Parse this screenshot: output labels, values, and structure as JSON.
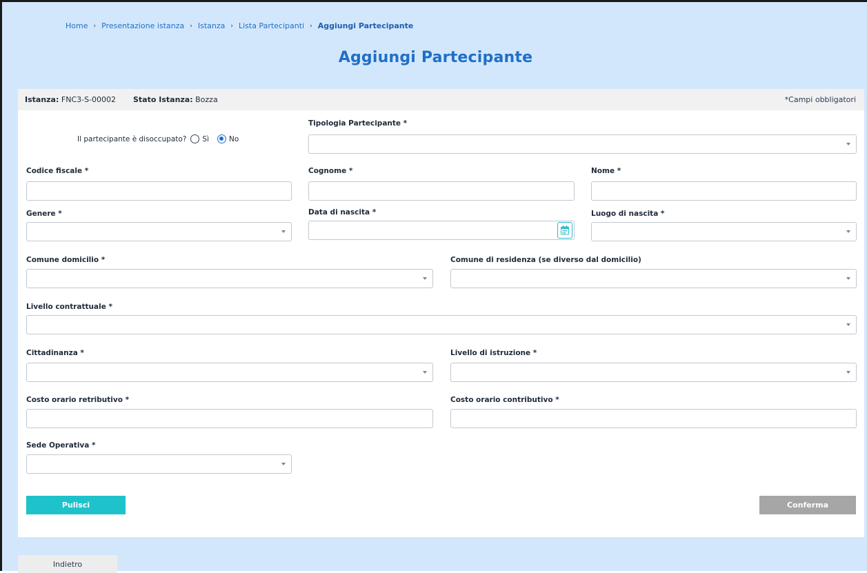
{
  "breadcrumb": {
    "items": [
      "Home",
      "Presentazione istanza",
      "Istanza",
      "Lista Partecipanti"
    ],
    "current": "Aggiungi Partecipante",
    "separator": "›"
  },
  "page": {
    "title": "Aggiungi Partecipante"
  },
  "info": {
    "istanza_label": "Istanza:",
    "istanza_value": "FNC3-S-00002",
    "stato_label": "Stato Istanza:",
    "stato_value": "Bozza",
    "required_note": "*Campi obbligatori"
  },
  "form": {
    "disoccupato": {
      "question": "Il partecipante è disoccupato?",
      "options": [
        "Sì",
        "No"
      ],
      "selected": "No"
    },
    "tipologia_partecipante": {
      "label": "Tipologia Partecipante *",
      "value": ""
    },
    "codice_fiscale": {
      "label": "Codice fiscale *",
      "value": ""
    },
    "cognome": {
      "label": "Cognome *",
      "value": ""
    },
    "nome": {
      "label": "Nome *",
      "value": ""
    },
    "genere": {
      "label": "Genere *",
      "value": ""
    },
    "data_nascita": {
      "label": "Data di nascita *",
      "value": ""
    },
    "luogo_nascita": {
      "label": "Luogo di nascita *",
      "value": ""
    },
    "comune_domicilio": {
      "label": "Comune domicilio *",
      "value": ""
    },
    "comune_residenza": {
      "label": "Comune di residenza (se diverso dal domicilio)",
      "value": ""
    },
    "livello_contrattuale": {
      "label": "Livello contrattuale *",
      "value": ""
    },
    "cittadinanza": {
      "label": "Cittadinanza *",
      "value": ""
    },
    "livello_istruzione": {
      "label": "Livello di istruzione *",
      "value": ""
    },
    "costo_retributivo": {
      "label": "Costo orario retributivo *",
      "value": ""
    },
    "costo_contributivo": {
      "label": "Costo orario contributivo *",
      "value": ""
    },
    "sede_operativa": {
      "label": "Sede Operativa *",
      "value": ""
    }
  },
  "buttons": {
    "pulisci": "Pulisci",
    "conferma": "Conferma",
    "indietro": "Indietro"
  },
  "colors": {
    "accent": "#1f6fc7",
    "header_bg": "#d3e7fc",
    "teal": "#1ec2cb",
    "disabled": "#a6a6a6"
  },
  "icons": {
    "calendar": "calendar-icon",
    "dropdown": "chevron-down-icon"
  }
}
